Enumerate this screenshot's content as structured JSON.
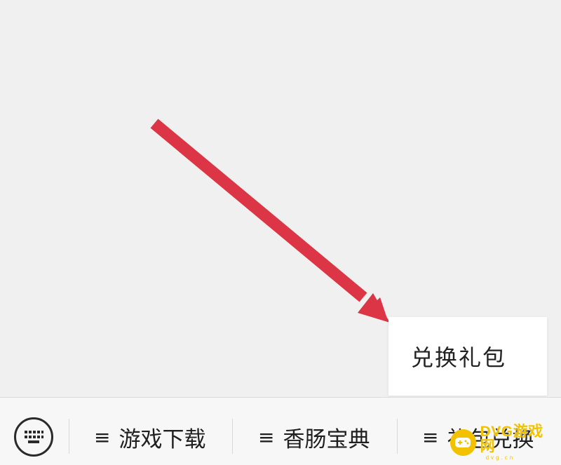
{
  "popup_menu": {
    "item_label": "兑换礼包"
  },
  "bottom_bar": {
    "menu_icon_glyph": "≡",
    "menus": [
      {
        "label": "游戏下载"
      },
      {
        "label": "香肠宝典"
      },
      {
        "label": "礼包兑换"
      }
    ]
  },
  "watermark": {
    "name": "DVG游戏网",
    "domain": "dvg.cn"
  },
  "colors": {
    "annotation_arrow": "#dc3545",
    "watermark": "#f2c200",
    "background": "#f0f0f0"
  }
}
